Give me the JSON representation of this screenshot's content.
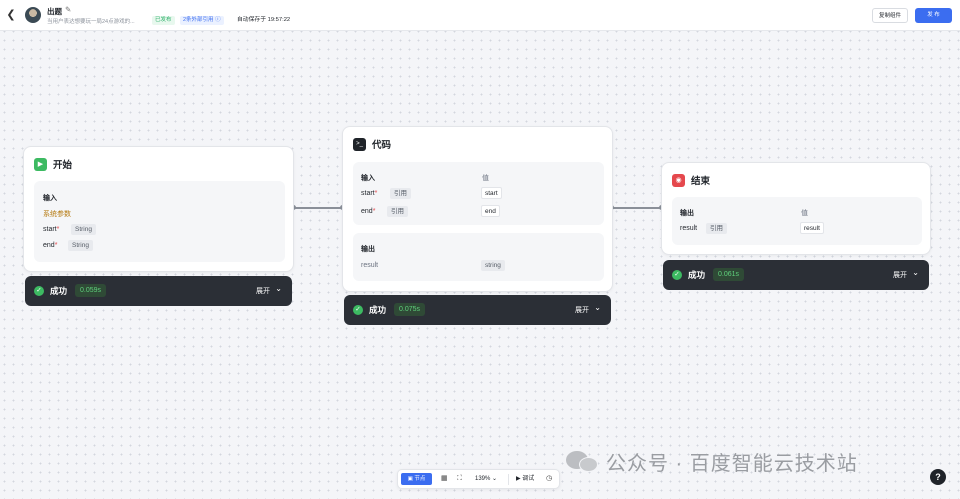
{
  "header": {
    "back_icon": "back-arrow-icon",
    "title": "出题",
    "edit_icon": "pencil-icon",
    "description": "当用户表达想要玩一局24点游戏的...",
    "badge_published": "已发布",
    "badge_refs": "2条外部引用 ⓘ",
    "autosave": "自动保存于 19:57:22",
    "copy_button": "复制组件",
    "publish_button": "发 布"
  },
  "nodes": {
    "start": {
      "title": "开始",
      "input_label": "输入",
      "sys_params": "系统参数",
      "params": [
        {
          "name": "start",
          "type": "String"
        },
        {
          "name": "end",
          "type": "String"
        }
      ],
      "status": {
        "label": "成功",
        "time": "0.059s",
        "expand": "展开"
      }
    },
    "code": {
      "title": "代码",
      "input_label": "输入",
      "value_label": "值",
      "inputs": [
        {
          "name": "start",
          "kind": "引用",
          "value": "start"
        },
        {
          "name": "end",
          "kind": "引用",
          "value": "end"
        }
      ],
      "output_label": "输出",
      "outputs": [
        {
          "name": "result",
          "type": "string"
        }
      ],
      "status": {
        "label": "成功",
        "time": "0.075s",
        "expand": "展开"
      }
    },
    "end": {
      "title": "结束",
      "output_label": "输出",
      "value_label": "值",
      "outputs": [
        {
          "name": "result",
          "kind": "引用",
          "value": "result"
        }
      ],
      "status": {
        "label": "成功",
        "time": "0.061s",
        "expand": "展开"
      }
    }
  },
  "toolbar": {
    "add_node": "▣ 节点",
    "zoom": "139% ⌄",
    "debug": "▶ 调试"
  },
  "watermark": "公众号 · 百度智能云技术站",
  "help": "?",
  "colors": {
    "accent": "#3b6df0",
    "success": "#3dba62",
    "danger": "#e5484d",
    "status_bar": "#2b2f36"
  }
}
